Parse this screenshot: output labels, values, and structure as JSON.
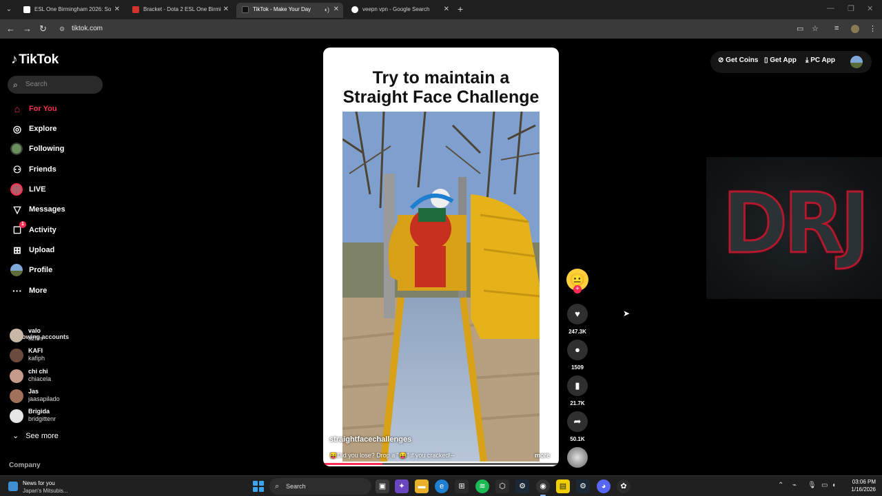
{
  "browser": {
    "tabs": [
      {
        "title": "ESL One Birmingham 2026: So",
        "favicon_color": "#ffffff",
        "active": false
      },
      {
        "title": "Bracket - Dota 2 ESL One Birmi",
        "favicon_color": "#d0342c",
        "active": false
      },
      {
        "title": "TikTok - Make Your Day",
        "favicon_color": "#111111",
        "active": true
      },
      {
        "title": "veepn vpn - Google Search",
        "favicon_color": "#4285f4",
        "active": false
      }
    ],
    "new_tab_icon": "plus-icon",
    "url": "tiktok.com"
  },
  "tiktok": {
    "logo_text": "TikTok",
    "search_placeholder": "Search",
    "nav": [
      {
        "label": "For You",
        "icon": "home-icon",
        "active": true
      },
      {
        "label": "Explore",
        "icon": "compass-icon",
        "active": false
      },
      {
        "label": "Following",
        "icon": "following-avatar",
        "active": false
      },
      {
        "label": "Friends",
        "icon": "friends-icon",
        "active": false
      },
      {
        "label": "LIVE",
        "icon": "live-avatar",
        "active": false
      },
      {
        "label": "Messages",
        "icon": "messages-icon",
        "active": false
      },
      {
        "label": "Activity",
        "icon": "activity-icon",
        "active": false,
        "badge": "1"
      },
      {
        "label": "Upload",
        "icon": "upload-icon",
        "active": false
      },
      {
        "label": "Profile",
        "icon": "profile-avatar",
        "active": false
      },
      {
        "label": "More",
        "icon": "more-icon",
        "active": false
      }
    ],
    "following_title": "Following accounts",
    "following_accounts": [
      {
        "name": "valo",
        "handle": "azflrs",
        "color": "#c9b8a8"
      },
      {
        "name": "KAFI",
        "handle": "kafiph",
        "color": "#6a4a3a"
      },
      {
        "name": "chi chi",
        "handle": "chiacela",
        "color": "#c59a8a"
      },
      {
        "name": "Jas",
        "handle": "jaasapilado",
        "color": "#a0705a"
      },
      {
        "name": "Brigida",
        "handle": "bridgittenr",
        "color": "#e6e6e6"
      }
    ],
    "see_more": "See more",
    "company": "Company",
    "header": {
      "get_coins": "Get Coins",
      "get_app": "Get App",
      "pc_app": "PC App"
    },
    "video": {
      "title_line1": "Try to maintain a",
      "title_line2": "Straight Face Challenge",
      "author": "straightfacechallenges",
      "caption": "😝Did you lose? Drop a \"😝\" if you cracked!--",
      "caption_more": "more",
      "progress_percent": 25,
      "likes": "247.3K",
      "comments": "1509",
      "saves": "21.7K",
      "shares": "50.1K"
    },
    "side_panel_text": "DRJ"
  },
  "taskbar": {
    "news_title": "News for you",
    "news_subtitle": "Japan's Mitsubis...",
    "search_label": "Search",
    "time": "03:06 PM",
    "date": "1/16/2026"
  }
}
